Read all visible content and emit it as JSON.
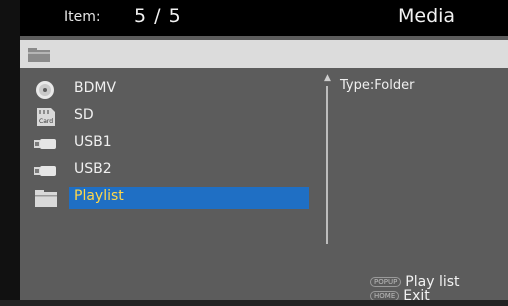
{
  "header": {
    "item_label": "Item:",
    "item_count": "5 / 5",
    "title": "Media"
  },
  "path_bar": {
    "icon": "folder-icon"
  },
  "list": {
    "items": [
      {
        "label": "BDMV",
        "icon": "disc-icon"
      },
      {
        "label": "SD",
        "icon": "sd-card-icon",
        "icon_text": "Card"
      },
      {
        "label": "USB1",
        "icon": "usb-icon"
      },
      {
        "label": "USB2",
        "icon": "usb-icon"
      },
      {
        "label": "Playlist",
        "icon": "folder-icon",
        "selected": true
      }
    ]
  },
  "info": {
    "type_text": "Type:Folder"
  },
  "footer": {
    "popup_key": "POPUP",
    "popup_action": "Play list",
    "home_key": "HOME",
    "home_action": "Exit"
  },
  "colors": {
    "background": "#5c5c5c",
    "header": "#000000",
    "path_bar": "#dcdcdc",
    "selection": "#1f6fc4",
    "selected_text": "#ffd84a"
  }
}
